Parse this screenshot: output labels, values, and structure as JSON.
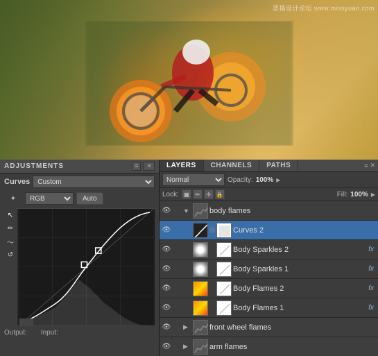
{
  "watermark": "恶搞设计论坛  www.missyuan.com",
  "adjustments": {
    "title": "ADJUSTMENTS",
    "close_btn": "✕",
    "menu_btn": "≡",
    "curve_label": "Curves",
    "curve_preset": "Custom",
    "channel": "RGB",
    "auto_label": "Auto",
    "output_label": "Output:",
    "input_label": "Input:"
  },
  "layers": {
    "tabs": [
      "LAYERS",
      "CHANNELS",
      "PATHS"
    ],
    "active_tab": "LAYERS",
    "blend_mode": "Normal",
    "opacity_label": "Opacity:",
    "opacity_value": "100%",
    "lock_label": "Lock:",
    "fill_label": "Fill:",
    "fill_value": "100%",
    "items": [
      {
        "name": "body flames",
        "type": "group",
        "visible": true,
        "indent": false,
        "has_fx": false
      },
      {
        "name": "Curves 2",
        "type": "curves",
        "visible": true,
        "indent": true,
        "has_fx": false,
        "selected": true
      },
      {
        "name": "Body Sparkles 2",
        "type": "sparkles",
        "visible": true,
        "indent": true,
        "has_fx": true
      },
      {
        "name": "Body Sparkles 1",
        "type": "sparkles",
        "visible": true,
        "indent": true,
        "has_fx": true
      },
      {
        "name": "Body Flames 2",
        "type": "flames",
        "visible": true,
        "indent": true,
        "has_fx": true
      },
      {
        "name": "Body Flames 1",
        "type": "flames",
        "visible": true,
        "indent": true,
        "has_fx": true
      },
      {
        "name": "front wheel flames",
        "type": "group",
        "visible": true,
        "indent": false,
        "has_fx": false
      },
      {
        "name": "arm flames",
        "type": "group",
        "visible": true,
        "indent": false,
        "has_fx": false
      }
    ]
  }
}
